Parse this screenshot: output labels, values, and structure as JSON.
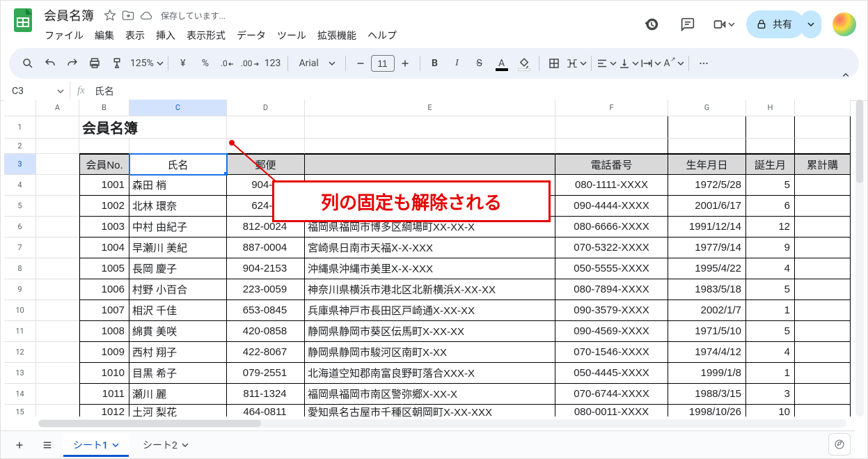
{
  "doc": {
    "title": "会員名簿",
    "saving": "保存しています..."
  },
  "menu": [
    "ファイル",
    "編集",
    "表示",
    "挿入",
    "表示形式",
    "データ",
    "ツール",
    "拡張機能",
    "ヘルプ"
  ],
  "share": {
    "label": "共有"
  },
  "toolbar": {
    "zoom": "125%",
    "currency": "¥",
    "percent": "%",
    "dec_dec": ".0",
    "inc_dec": ".00",
    "formatnum": "123",
    "font": "Arial",
    "size": "11"
  },
  "namebox": "C3",
  "formula": "氏名",
  "columns": [
    "A",
    "B",
    "C",
    "D",
    "E",
    "F",
    "G",
    "H"
  ],
  "lastcol": "累計購",
  "rows": [
    "1",
    "2",
    "3",
    "4",
    "5",
    "6",
    "7",
    "8",
    "9",
    "10",
    "11",
    "12",
    "13",
    "14",
    "15"
  ],
  "title_cell": "会員名簿",
  "headers": [
    "会員No.",
    "氏名",
    "郵便",
    "",
    "電話番号",
    "生年月日",
    "誕生月"
  ],
  "data": [
    {
      "no": "1001",
      "name": "森田 梢",
      "zip": "904-0",
      "addr": "",
      "tel": "080-1111-XXXX",
      "dob": "1972/5/28",
      "m": "5"
    },
    {
      "no": "1002",
      "name": "北林 環奈",
      "zip": "624-0",
      "addr": "",
      "tel": "090-4444-XXXX",
      "dob": "2001/6/17",
      "m": "6"
    },
    {
      "no": "1003",
      "name": "中村 由紀子",
      "zip": "812-0024",
      "addr": "福岡県福岡市博多区綱場町XX-XX-X",
      "tel": "080-6666-XXXX",
      "dob": "1991/12/14",
      "m": "12"
    },
    {
      "no": "1004",
      "name": "早瀬川 美紀",
      "zip": "887-0004",
      "addr": "宮崎県日南市天福X-X-XXX",
      "tel": "070-5322-XXXX",
      "dob": "1977/9/14",
      "m": "9"
    },
    {
      "no": "1005",
      "name": "長岡 慶子",
      "zip": "904-2153",
      "addr": "沖縄県沖縄市美里X-X-XXX",
      "tel": "050-5555-XXXX",
      "dob": "1995/4/22",
      "m": "4"
    },
    {
      "no": "1006",
      "name": "村野 小百合",
      "zip": "223-0059",
      "addr": "神奈川県横浜市港北区北新横浜X-XX-XX",
      "tel": "080-7894-XXXX",
      "dob": "1983/5/18",
      "m": "5"
    },
    {
      "no": "1007",
      "name": "相沢 千佳",
      "zip": "653-0845",
      "addr": "兵庫県神戸市長田区戸崎通X-XX-XX",
      "tel": "090-3579-XXXX",
      "dob": "2002/1/7",
      "m": "1"
    },
    {
      "no": "1008",
      "name": "綿貫 美咲",
      "zip": "420-0858",
      "addr": "静岡県静岡市葵区伝馬町X-XX-XX",
      "tel": "090-4569-XXXX",
      "dob": "1971/5/10",
      "m": "5"
    },
    {
      "no": "1009",
      "name": "西村 翔子",
      "zip": "422-8067",
      "addr": "静岡県静岡市駿河区南町X-XX",
      "tel": "070-1546-XXXX",
      "dob": "1974/4/12",
      "m": "4"
    },
    {
      "no": "1010",
      "name": "目黒 希子",
      "zip": "079-2551",
      "addr": "北海道空知郡南富良野町落合XXX-X",
      "tel": "050-4445-XXXX",
      "dob": "1999/1/8",
      "m": "1"
    },
    {
      "no": "1011",
      "name": "瀬川 麗",
      "zip": "811-1324",
      "addr": "福岡県福岡市南区警弥郷X-XX-X",
      "tel": "070-6744-XXXX",
      "dob": "1988/3/15",
      "m": "3"
    },
    {
      "no": "1012",
      "name": "土河 梨花",
      "zip": "464-0811",
      "addr": "愛知県名古屋市千種区朝岡町X-XX-XXX",
      "tel": "080-0011-XXXX",
      "dob": "1998/10/26",
      "m": "10"
    }
  ],
  "callout": "列の固定も解除される",
  "sheets": {
    "add": "+",
    "s1": "シート1",
    "s2": "シート2"
  }
}
